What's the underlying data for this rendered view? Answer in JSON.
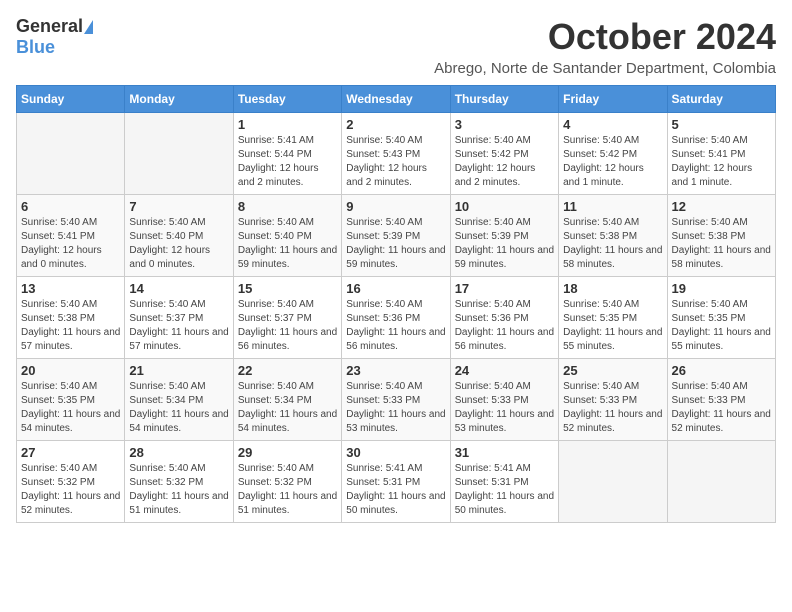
{
  "logo": {
    "general": "General",
    "blue": "Blue"
  },
  "header": {
    "month": "October 2024",
    "location": "Abrego, Norte de Santander Department, Colombia"
  },
  "weekdays": [
    "Sunday",
    "Monday",
    "Tuesday",
    "Wednesday",
    "Thursday",
    "Friday",
    "Saturday"
  ],
  "weeks": [
    [
      {
        "day": "",
        "info": ""
      },
      {
        "day": "",
        "info": ""
      },
      {
        "day": "1",
        "info": "Sunrise: 5:41 AM\nSunset: 5:44 PM\nDaylight: 12 hours and 2 minutes."
      },
      {
        "day": "2",
        "info": "Sunrise: 5:40 AM\nSunset: 5:43 PM\nDaylight: 12 hours and 2 minutes."
      },
      {
        "day": "3",
        "info": "Sunrise: 5:40 AM\nSunset: 5:42 PM\nDaylight: 12 hours and 2 minutes."
      },
      {
        "day": "4",
        "info": "Sunrise: 5:40 AM\nSunset: 5:42 PM\nDaylight: 12 hours and 1 minute."
      },
      {
        "day": "5",
        "info": "Sunrise: 5:40 AM\nSunset: 5:41 PM\nDaylight: 12 hours and 1 minute."
      }
    ],
    [
      {
        "day": "6",
        "info": "Sunrise: 5:40 AM\nSunset: 5:41 PM\nDaylight: 12 hours and 0 minutes."
      },
      {
        "day": "7",
        "info": "Sunrise: 5:40 AM\nSunset: 5:40 PM\nDaylight: 12 hours and 0 minutes."
      },
      {
        "day": "8",
        "info": "Sunrise: 5:40 AM\nSunset: 5:40 PM\nDaylight: 11 hours and 59 minutes."
      },
      {
        "day": "9",
        "info": "Sunrise: 5:40 AM\nSunset: 5:39 PM\nDaylight: 11 hours and 59 minutes."
      },
      {
        "day": "10",
        "info": "Sunrise: 5:40 AM\nSunset: 5:39 PM\nDaylight: 11 hours and 59 minutes."
      },
      {
        "day": "11",
        "info": "Sunrise: 5:40 AM\nSunset: 5:38 PM\nDaylight: 11 hours and 58 minutes."
      },
      {
        "day": "12",
        "info": "Sunrise: 5:40 AM\nSunset: 5:38 PM\nDaylight: 11 hours and 58 minutes."
      }
    ],
    [
      {
        "day": "13",
        "info": "Sunrise: 5:40 AM\nSunset: 5:38 PM\nDaylight: 11 hours and 57 minutes."
      },
      {
        "day": "14",
        "info": "Sunrise: 5:40 AM\nSunset: 5:37 PM\nDaylight: 11 hours and 57 minutes."
      },
      {
        "day": "15",
        "info": "Sunrise: 5:40 AM\nSunset: 5:37 PM\nDaylight: 11 hours and 56 minutes."
      },
      {
        "day": "16",
        "info": "Sunrise: 5:40 AM\nSunset: 5:36 PM\nDaylight: 11 hours and 56 minutes."
      },
      {
        "day": "17",
        "info": "Sunrise: 5:40 AM\nSunset: 5:36 PM\nDaylight: 11 hours and 56 minutes."
      },
      {
        "day": "18",
        "info": "Sunrise: 5:40 AM\nSunset: 5:35 PM\nDaylight: 11 hours and 55 minutes."
      },
      {
        "day": "19",
        "info": "Sunrise: 5:40 AM\nSunset: 5:35 PM\nDaylight: 11 hours and 55 minutes."
      }
    ],
    [
      {
        "day": "20",
        "info": "Sunrise: 5:40 AM\nSunset: 5:35 PM\nDaylight: 11 hours and 54 minutes."
      },
      {
        "day": "21",
        "info": "Sunrise: 5:40 AM\nSunset: 5:34 PM\nDaylight: 11 hours and 54 minutes."
      },
      {
        "day": "22",
        "info": "Sunrise: 5:40 AM\nSunset: 5:34 PM\nDaylight: 11 hours and 54 minutes."
      },
      {
        "day": "23",
        "info": "Sunrise: 5:40 AM\nSunset: 5:33 PM\nDaylight: 11 hours and 53 minutes."
      },
      {
        "day": "24",
        "info": "Sunrise: 5:40 AM\nSunset: 5:33 PM\nDaylight: 11 hours and 53 minutes."
      },
      {
        "day": "25",
        "info": "Sunrise: 5:40 AM\nSunset: 5:33 PM\nDaylight: 11 hours and 52 minutes."
      },
      {
        "day": "26",
        "info": "Sunrise: 5:40 AM\nSunset: 5:33 PM\nDaylight: 11 hours and 52 minutes."
      }
    ],
    [
      {
        "day": "27",
        "info": "Sunrise: 5:40 AM\nSunset: 5:32 PM\nDaylight: 11 hours and 52 minutes."
      },
      {
        "day": "28",
        "info": "Sunrise: 5:40 AM\nSunset: 5:32 PM\nDaylight: 11 hours and 51 minutes."
      },
      {
        "day": "29",
        "info": "Sunrise: 5:40 AM\nSunset: 5:32 PM\nDaylight: 11 hours and 51 minutes."
      },
      {
        "day": "30",
        "info": "Sunrise: 5:41 AM\nSunset: 5:31 PM\nDaylight: 11 hours and 50 minutes."
      },
      {
        "day": "31",
        "info": "Sunrise: 5:41 AM\nSunset: 5:31 PM\nDaylight: 11 hours and 50 minutes."
      },
      {
        "day": "",
        "info": ""
      },
      {
        "day": "",
        "info": ""
      }
    ]
  ]
}
